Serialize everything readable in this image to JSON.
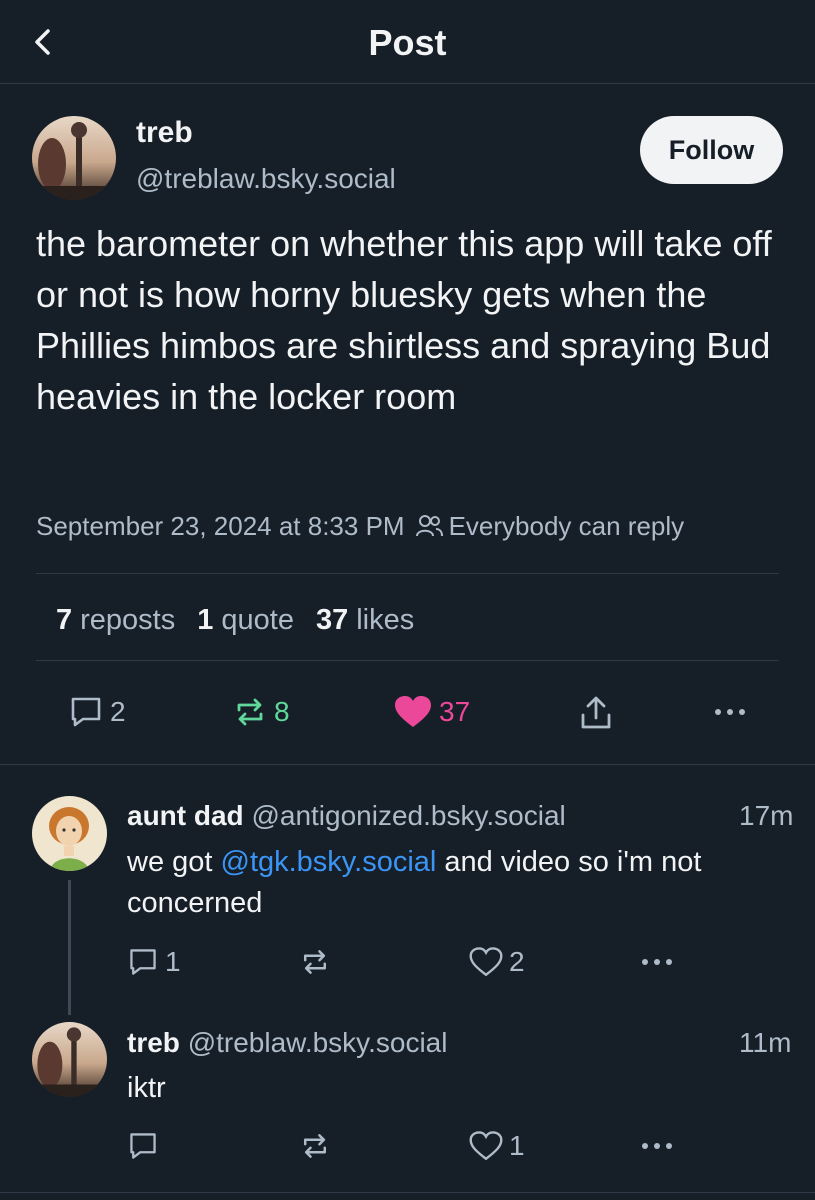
{
  "header": {
    "title": "Post",
    "back_icon": "chevron-left-icon"
  },
  "post": {
    "author_name": "treb",
    "author_handle": "@treblaw.bsky.social",
    "follow_label": "Follow",
    "text": "the barometer on whether this app will take off or not is how horny bluesky gets when the Phillies himbos are shirtless and spraying Bud heavies in the locker room",
    "timestamp": "September 23, 2024 at 8:33 PM",
    "reply_setting": "Everybody can reply",
    "stats": {
      "reposts_count": "7",
      "reposts_label": "reposts",
      "quotes_count": "1",
      "quotes_label": "quote",
      "likes_count": "37",
      "likes_label": "likes"
    },
    "actions": {
      "replies": "2",
      "reposts": "8",
      "likes": "37"
    }
  },
  "replies": [
    {
      "name": "aunt dad",
      "handle": "@antigonized.bsky.social",
      "time": "17m",
      "text_before": "we got ",
      "mention": "@tgk.bsky.social",
      "text_after": " and video so i'm not concerned",
      "reply_count": "1",
      "like_count": "2"
    },
    {
      "name": "treb",
      "handle": "@treblaw.bsky.social",
      "time": "11m",
      "text": "iktr",
      "like_count": "1"
    }
  ],
  "colors": {
    "background": "#161e27",
    "text": "#f1f3f5",
    "muted": "#aebbc9",
    "repost_active": "#5fd89a",
    "like_active": "#ec4899",
    "mention": "#3b95f5"
  }
}
